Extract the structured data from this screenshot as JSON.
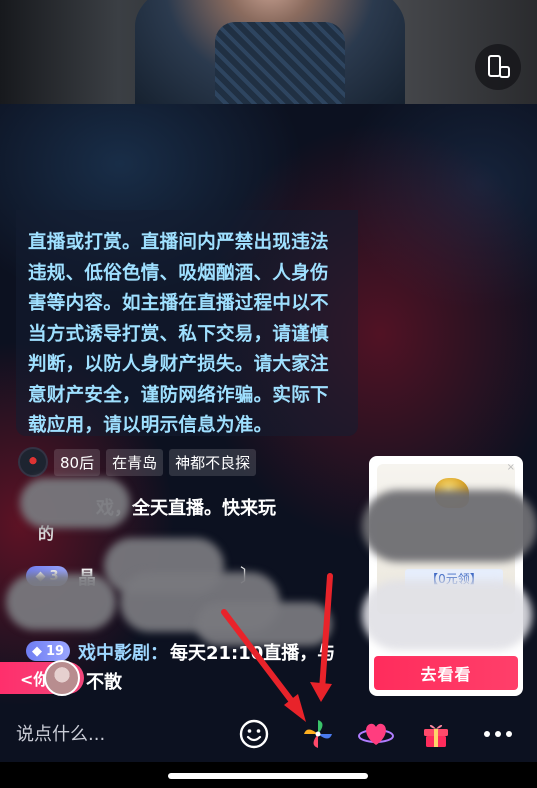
{
  "notice": {
    "lines": [
      "直播或打赏。直播间内严禁出现违法",
      "违规、低俗色情、吸烟酗酒、人身伤",
      "害等内容。如主播在直播过程中以不",
      "当方式诱导打赏、私下交易，请谨慎",
      "判断，以防人身财产损失。请大家注",
      "意财产安全，谨防网络诈骗。实际下",
      "载应用，请以明示信息为准。"
    ]
  },
  "chat": {
    "user_tags": [
      "80后",
      "在青岛",
      "神都不良探"
    ],
    "msg1": "戏，全天直播。快来玩",
    "msg1_b": "的",
    "msg2_badge": "3",
    "msg2_text": "晶",
    "msg2_tail": "〕",
    "msg3_badge": "19",
    "msg3_name": "戏中影剧：",
    "msg3_text": "每天21:10直播，与",
    "msg3_text2": "不散",
    "back_label": "<你"
  },
  "card": {
    "free_label": "【0元领】",
    "go_label": "去看看",
    "close": "×"
  },
  "input": {
    "placeholder": "说点什么..."
  },
  "icons": {
    "rotate": "rotate-screen-icon",
    "emoji": "smile-icon",
    "pinwheel": "pinwheel-icon",
    "heart": "heart-planet-icon",
    "gift": "gift-icon",
    "more": "more-dots-icon"
  },
  "colors": {
    "notice_text": "#9fe0ff",
    "accent": "#ff2c5c",
    "badge": "#6f7df2"
  }
}
